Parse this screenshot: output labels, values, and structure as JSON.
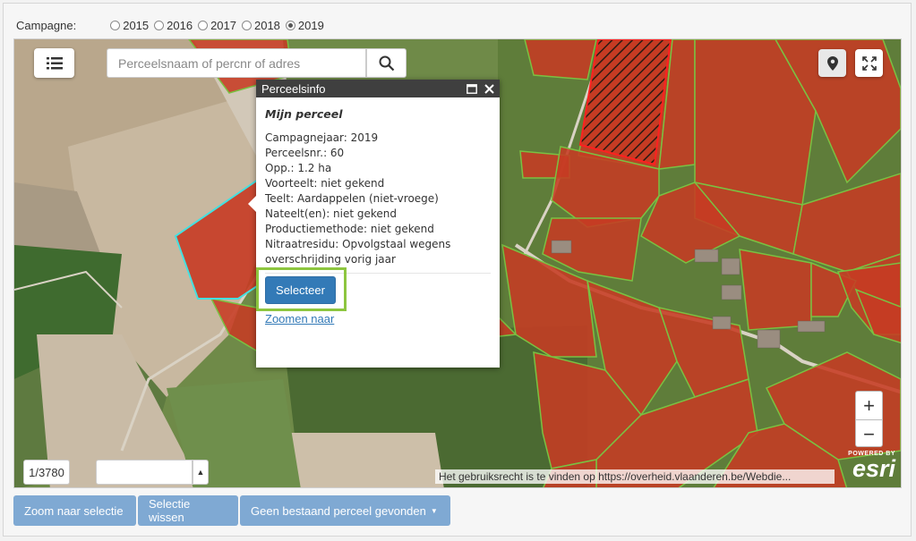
{
  "campaign": {
    "label": "Campagne:",
    "options": [
      "2015",
      "2016",
      "2017",
      "2018",
      "2019"
    ],
    "selected": "2019"
  },
  "search": {
    "placeholder": "Perceelsnaam of percnr of adres"
  },
  "popup": {
    "header": "Perceelsinfo",
    "title": "Mijn perceel",
    "lines": [
      "Campagnejaar: 2019",
      "Perceelsnr.: 60",
      "Opp.: 1.2 ha",
      "Voorteelt: niet gekend",
      "Teelt: Aardappelen (niet-vroege)",
      "Nateelt(en): niet gekend",
      "Productiemethode: niet gekend",
      "Nitraatresidu: Opvolgstaal wegens",
      "overschrijding vorig jaar"
    ],
    "select_label": "Selecteer",
    "zoom_label": "Zoomen naar"
  },
  "map": {
    "zoom_in": "+",
    "zoom_out": "−",
    "page_indicator": "1/3780",
    "attribution": "Het gebruiksrecht is te vinden op https://overheid.vlaanderen.be/Webdie...",
    "esri_powered": "POWERED BY",
    "esri_brand": "esri"
  },
  "toolbar": {
    "zoom_selection": "Zoom naar selectie",
    "clear_selection": "Selectie wissen",
    "no_parcel": "Geen bestaand perceel gevonden"
  },
  "colors": {
    "parcel_fill": "#c63b23",
    "parcel_border": "#7ac142",
    "selected_border": "#45e0e0",
    "highlight_border": "#ff2020",
    "button_primary": "#337ab7",
    "toolbar_button": "#7fa9d3"
  }
}
